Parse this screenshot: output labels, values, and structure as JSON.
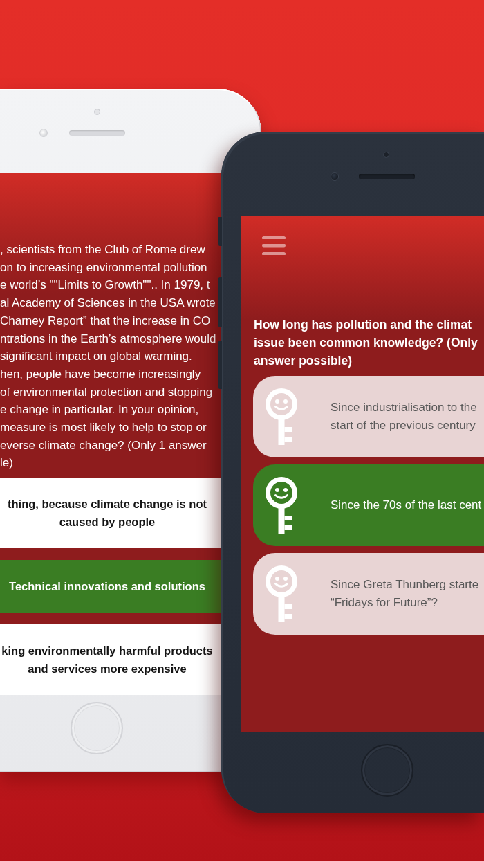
{
  "left_phone": {
    "intro_lines": [
      ", scientists from the Club of Rome drew",
      "on to increasing environmental pollution",
      "e world’s \"\"Limits to Growth\"\".. In 1979, t",
      "al Academy of Sciences in the USA wrote",
      "Charney Report” that the increase in CO",
      "ntrations in the Earth’s atmosphere would",
      "significant impact on global warming.",
      "hen, people have become increasingly",
      "of environmental protection and stopping",
      "e change in particular. In your opinion,",
      "measure is most likely to help to stop or",
      "everse climate change? (Only 1 answer",
      "le)"
    ],
    "answers": [
      {
        "lines": [
          "thing, because climate change is not",
          "caused by people"
        ],
        "selected": false
      },
      {
        "lines": [
          "Technical innovations and solutions"
        ],
        "selected": true
      },
      {
        "lines": [
          "king environmentally harmful products",
          "and services more expensive"
        ],
        "selected": false
      }
    ]
  },
  "right_phone": {
    "question_lines": [
      "How long has pollution and the climat",
      "issue been common knowledge? (Only",
      "answer possible)"
    ],
    "answers": [
      {
        "lines": [
          "Since industrialisation to the",
          "start of the previous century"
        ],
        "selected": false
      },
      {
        "lines": [
          "Since the 70s of the last cent"
        ],
        "selected": true
      },
      {
        "lines": [
          "Since Greta Thunberg starte",
          "“Fridays for Future”?"
        ],
        "selected": false
      }
    ]
  }
}
